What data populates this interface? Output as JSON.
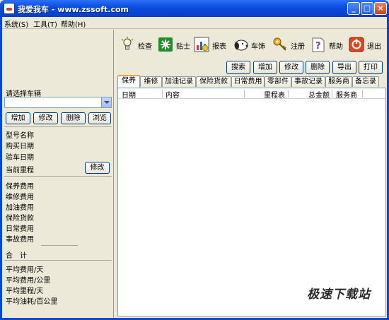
{
  "window": {
    "title": "我爱我车 - www.zssoft.com"
  },
  "menu": [
    {
      "label": "系统(S)"
    },
    {
      "label": "工具(T)"
    },
    {
      "label": "帮助(H)"
    }
  ],
  "left": {
    "select_vehicle_label": "请选择车辆",
    "buttons": [
      "增加",
      "修改",
      "删除",
      "浏览"
    ],
    "info_labels": [
      "型号名称",
      "购买日期",
      "验车日期",
      "当前里程"
    ],
    "mileage_edit_button": "修改",
    "cost_labels": [
      "保养费用",
      "维修费用",
      "加油费用",
      "保险货款",
      "日常费用",
      "事故费用"
    ],
    "total_label": "合　计",
    "avg_labels": [
      "平均费用/天",
      "平均费用/公里",
      "平均里程/天",
      "平均油耗/百公里"
    ]
  },
  "toolbar": [
    {
      "label": "检查",
      "icon": "lightbulb-icon"
    },
    {
      "label": "贴士",
      "icon": "tips-icon"
    },
    {
      "label": "报表",
      "icon": "report-icon"
    },
    {
      "label": "车饰",
      "icon": "snoopy-icon"
    },
    {
      "label": "注册",
      "icon": "key-icon"
    },
    {
      "label": "帮助",
      "icon": "help-icon"
    },
    {
      "label": "退出",
      "icon": "exit-icon"
    }
  ],
  "actions": [
    "搜索",
    "增加",
    "修改",
    "删除",
    "导出",
    "打印"
  ],
  "tabs": [
    "保养",
    "维修",
    "加油记录",
    "保险货款",
    "日常费用",
    "零部件",
    "事故记录",
    "服务商",
    "备忘录"
  ],
  "table": {
    "columns": [
      "日期",
      "内容",
      "里程表",
      "总金额",
      "服务商"
    ]
  },
  "watermark": "极速下载站",
  "colors": {
    "titlebar": "#0a4ee0",
    "face": "#ece9d8",
    "active_tab": "#f0a33c"
  }
}
